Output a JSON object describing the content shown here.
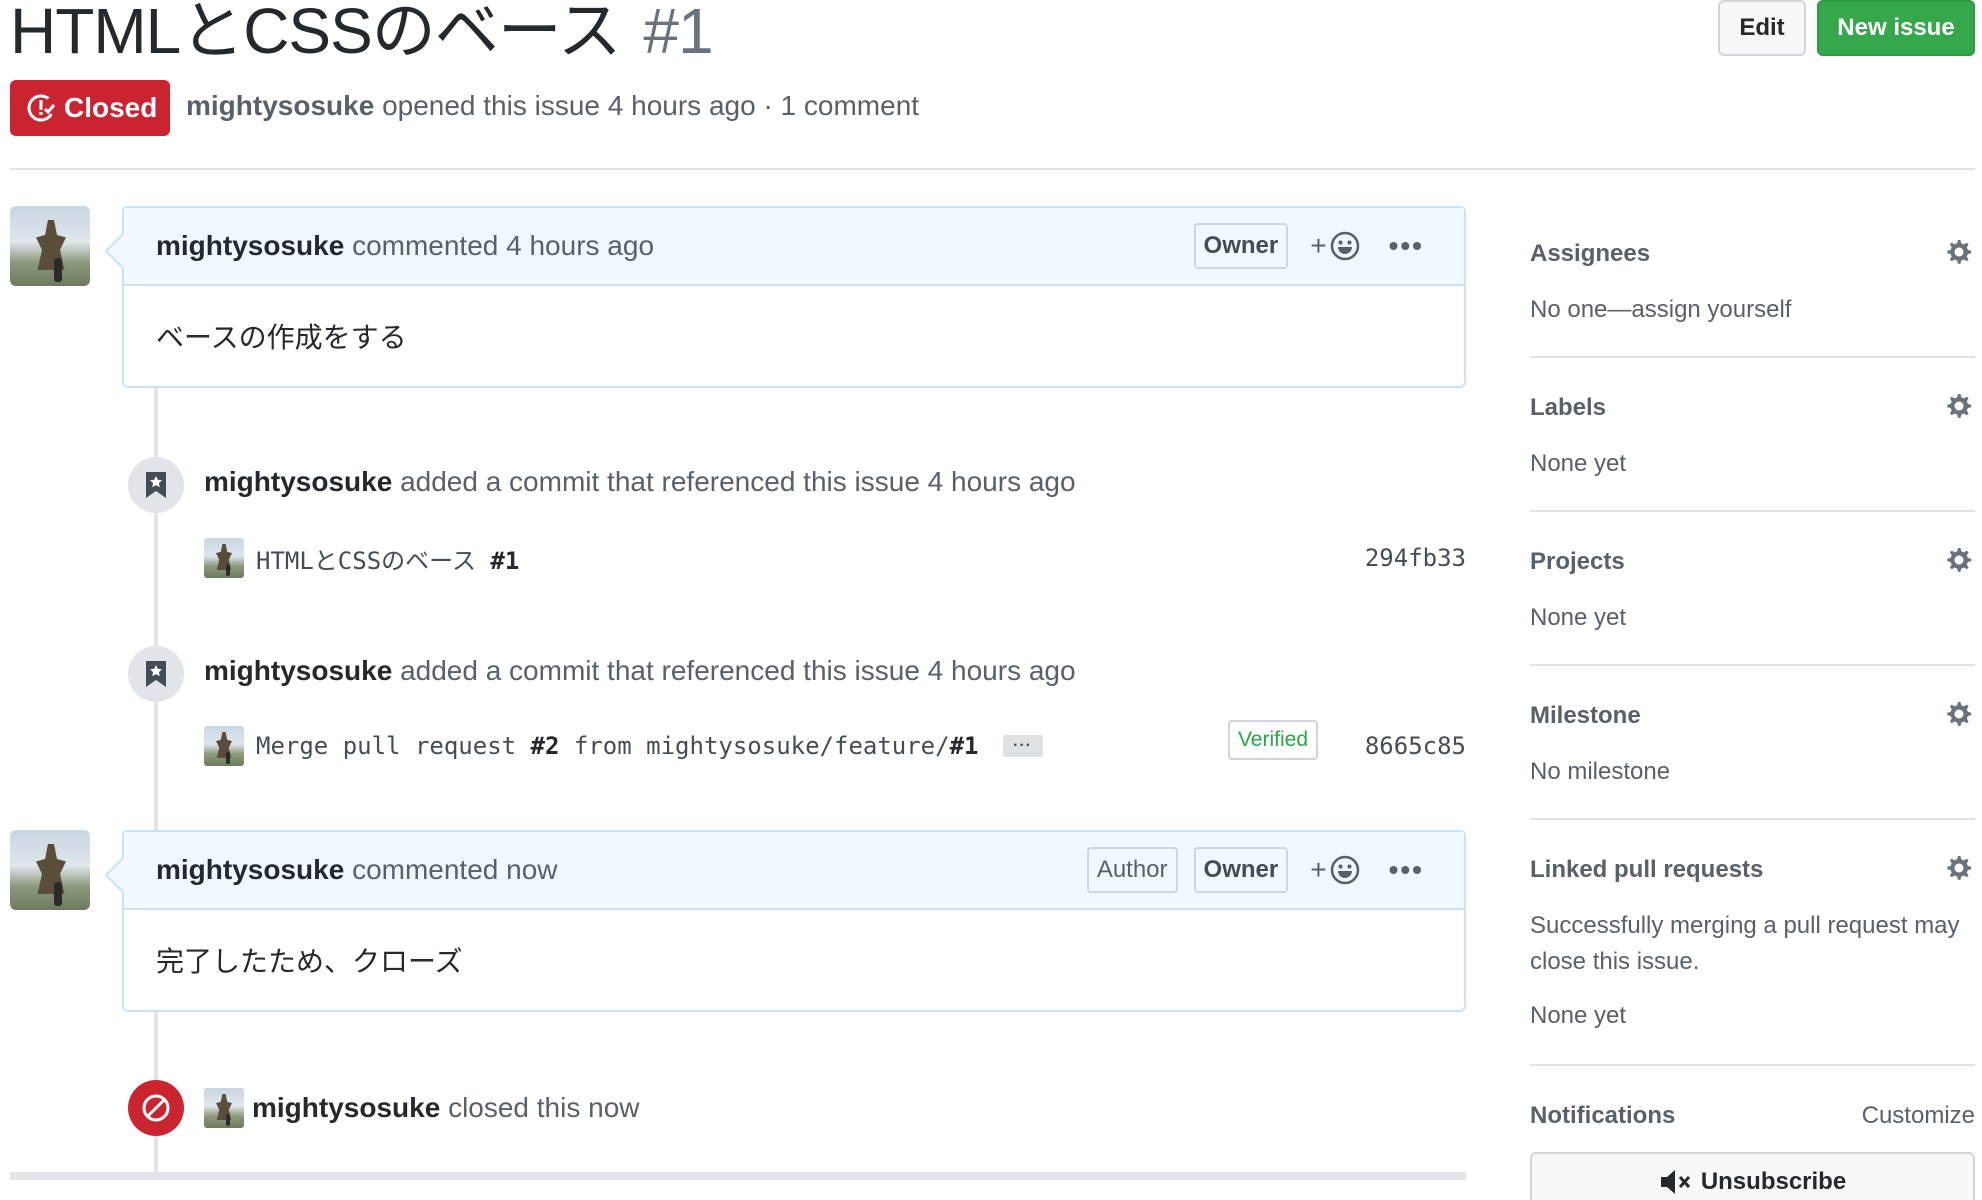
{
  "header": {
    "title": "HTMLとCSSのベース",
    "number": "#1",
    "edit_label": "Edit",
    "new_issue_label": "New issue",
    "state": "Closed",
    "author": "mightysosuke",
    "opened_text": "opened this issue 4 hours ago · 1 comment"
  },
  "comments": [
    {
      "author": "mightysosuke",
      "action": "commented 4 hours ago",
      "roles": [
        "Owner"
      ],
      "react_label": "+",
      "body": "ベースの作成をする"
    },
    {
      "author": "mightysosuke",
      "action": "commented now",
      "roles": [
        "Author",
        "Owner"
      ],
      "react_label": "+",
      "body": "完了したため、クローズ"
    }
  ],
  "events": [
    {
      "author": "mightysosuke",
      "text": "added a commit that referenced this issue 4 hours ago",
      "commit_msg": "HTMLとCSSのベース ",
      "commit_ref": "#1",
      "sha": "294fb33"
    },
    {
      "author": "mightysosuke",
      "text": "added a commit that referenced this issue 4 hours ago",
      "commit_msg_pre": "Merge pull request ",
      "commit_ref_a": "#2",
      "commit_msg_mid": " from mightysosuke/feature/",
      "commit_ref_b": "#1",
      "ellipsis": "···",
      "verified": "Verified",
      "sha": "8665c85"
    }
  ],
  "closed_event": {
    "author": "mightysosuke",
    "text": "closed this now"
  },
  "sidebar": {
    "assignees": {
      "title": "Assignees",
      "value": "No one—assign yourself"
    },
    "labels": {
      "title": "Labels",
      "value": "None yet"
    },
    "projects": {
      "title": "Projects",
      "value": "None yet"
    },
    "milestone": {
      "title": "Milestone",
      "value": "No milestone"
    },
    "linked_prs": {
      "title": "Linked pull requests",
      "desc": "Successfully merging a pull request may close this issue.",
      "value": "None yet"
    },
    "notifications": {
      "title": "Notifications",
      "customize": "Customize",
      "unsubscribe": "Unsubscribe"
    }
  },
  "colors": {
    "closed_red": "#cb2431",
    "new_issue_green": "#34a84a",
    "comment_border": "#c8e1ff",
    "comment_header_bg": "#f1f8ff"
  },
  "icons": {
    "state": "issue-closed-icon",
    "reaction": "smiley-icon",
    "more": "kebab-horizontal-icon",
    "event": "bookmark-icon",
    "closed": "circle-slash-icon",
    "sidebar_settings": "gear-icon",
    "unsubscribe": "mute-icon"
  }
}
